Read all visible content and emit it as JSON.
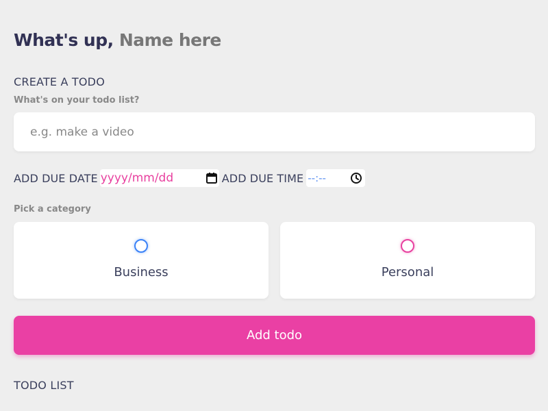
{
  "greeting": {
    "prefix": "What's up,",
    "name_placeholder": "Name here"
  },
  "create": {
    "title": "CREATE A TODO",
    "question": "What's on your todo list?",
    "input_placeholder": "e.g. make a video",
    "input_value": "",
    "due_date_label": "ADD DUE DATE",
    "due_date_placeholder": "yyyy/mm/dd",
    "due_time_label": "ADD DUE TIME",
    "due_time_placeholder": "--:--",
    "category_question": "Pick a category",
    "categories": [
      {
        "label": "Business",
        "color": "#3a82f7",
        "selected": false
      },
      {
        "label": "Personal",
        "color": "#e8409f",
        "selected": false
      }
    ],
    "submit_label": "Add todo"
  },
  "list": {
    "title": "TODO LIST"
  },
  "colors": {
    "background": "#eeeeee",
    "heading": "#313154",
    "accent_pink": "#ea40a4",
    "accent_blue": "#3a82f7",
    "muted": "#888888"
  },
  "icons": {
    "date_picker": "calendar-icon",
    "time_picker": "clock-icon"
  }
}
